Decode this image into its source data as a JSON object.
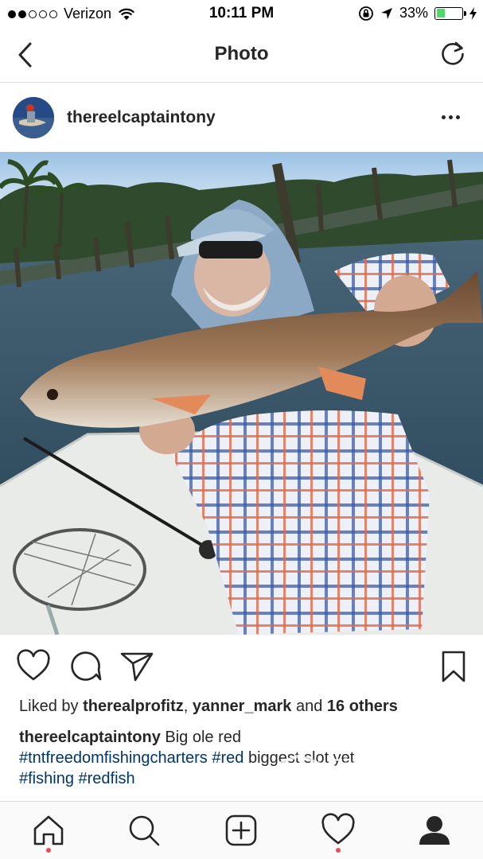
{
  "status_bar": {
    "carrier": "Verizon",
    "time": "10:11 PM",
    "battery_percent": "33%",
    "battery_level": 0.33,
    "signal_bars_filled": 2,
    "signal_bars_total": 5
  },
  "nav": {
    "title": "Photo"
  },
  "post": {
    "username": "thereelcaptaintony",
    "likes": {
      "prefix": "Liked by ",
      "user1": "therealprofitz",
      "separator": ", ",
      "user2": "yanner_mark",
      "middle": " and ",
      "others": "16 others"
    },
    "caption": {
      "user": "thereelcaptaintony",
      "text": " Big ole red",
      "tag1": "#tntfreedomfishingcharters",
      "tag2": "#red",
      "text2": " biggest slot yet",
      "tag3": "#fishing",
      "tag4": "#redfish"
    }
  },
  "watermark": {
    "line1": "Fishing",
    "line2": "Booker"
  },
  "icons": {
    "back": "chevron-left-icon",
    "refresh": "refresh-icon",
    "more": "more-icon",
    "like": "heart-icon",
    "comment": "comment-icon",
    "share": "send-icon",
    "save": "bookmark-icon",
    "home": "home-icon",
    "search": "search-icon",
    "add": "add-icon",
    "activity": "heart-icon",
    "profile": "profile-icon"
  },
  "colors": {
    "hashtag": "#003569",
    "notification_dot": "#ed4956",
    "battery": "#4cd964"
  }
}
